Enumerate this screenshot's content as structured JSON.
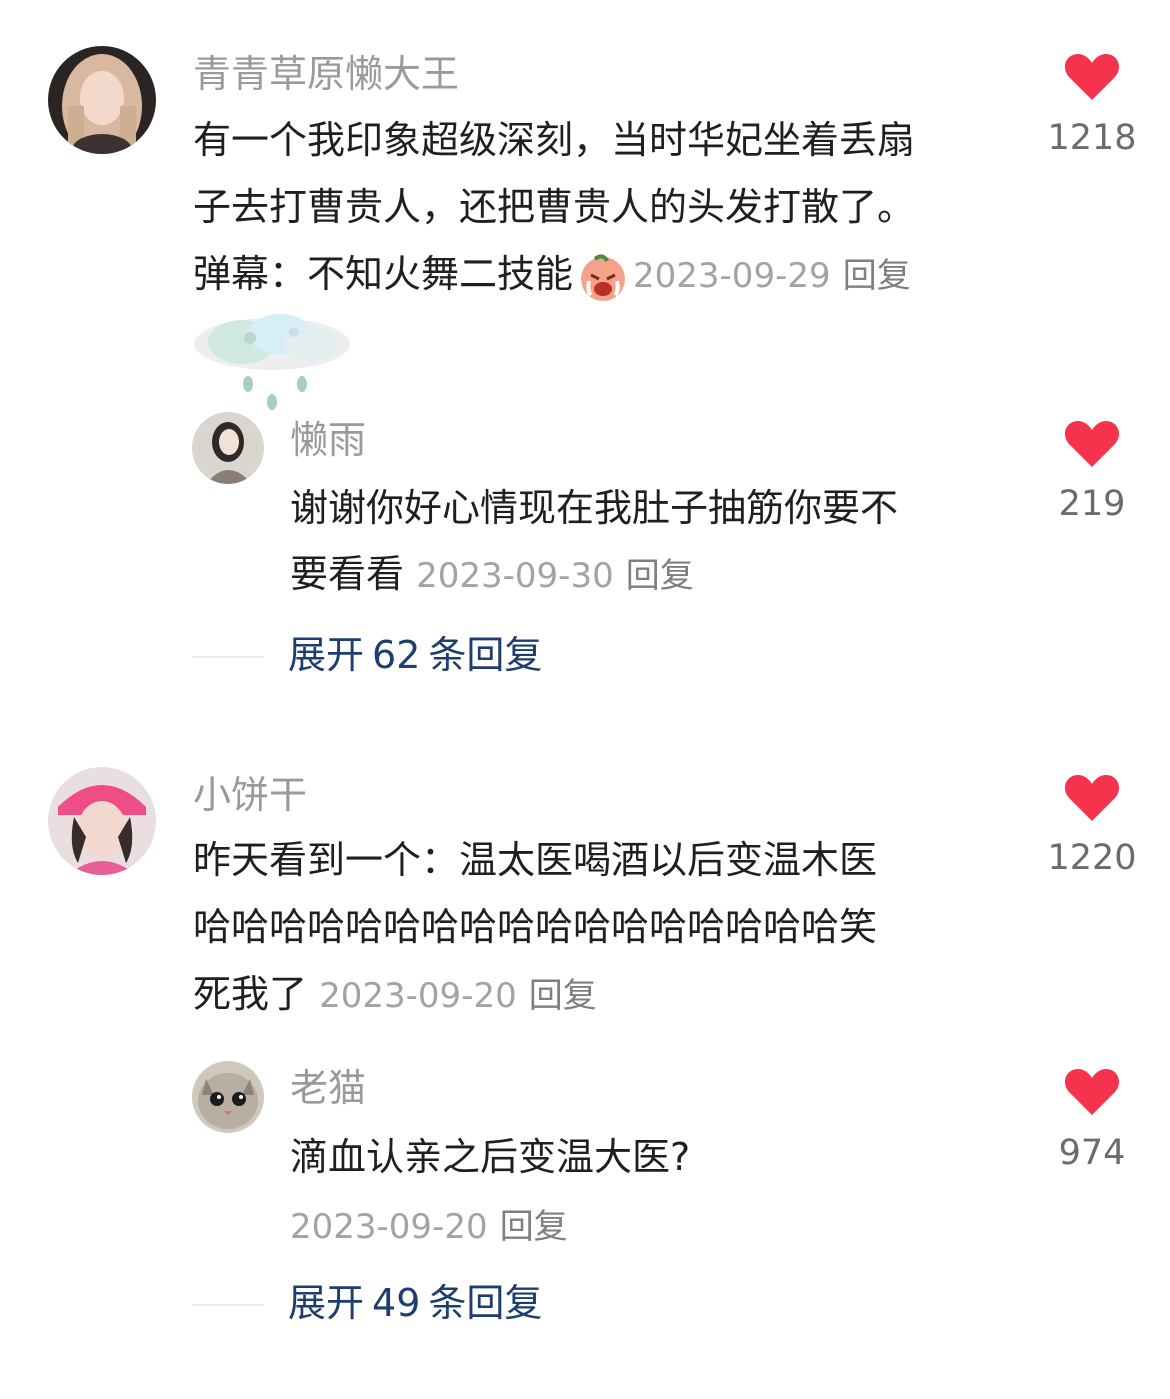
{
  "comments": [
    {
      "username": "青青草原懒大王",
      "lines": [
        "有一个我印象超级深刻，当时华妃坐着丢扇",
        "子去打曹贵人，还把曹贵人的头发打散了。",
        "弹幕：不知火舞二技能"
      ],
      "date": "2023-09-29",
      "reply_label": "回复",
      "likes": "1218",
      "reply": {
        "username": "懒雨",
        "lines": [
          "谢谢你好心情现在我肚子抽筋你要不",
          "要看看"
        ],
        "date": "2023-09-30",
        "reply_label": "回复",
        "likes": "219"
      },
      "expand": {
        "prefix": "展开",
        "count": "62",
        "suffix": "条回复"
      }
    },
    {
      "username": "小饼干",
      "lines": [
        "昨天看到一个：温太医喝酒以后变温木医",
        "哈哈哈哈哈哈哈哈哈哈哈哈哈哈哈哈哈笑",
        "死我了"
      ],
      "date": "2023-09-20",
      "reply_label": "回复",
      "likes": "1220",
      "reply": {
        "username": "老猫",
        "lines": [
          "滴血认亲之后变温大医?"
        ],
        "date": "2023-09-20",
        "reply_label": "回复",
        "likes": "974"
      },
      "expand": {
        "prefix": "展开",
        "count": "49",
        "suffix": "条回复"
      }
    }
  ],
  "icons": {
    "like": "heart-icon",
    "emoji": "crying-face-emoji",
    "sticker": "rain-cloud-sticker"
  },
  "colors": {
    "like": "#f5334d",
    "link": "#1d3e6e",
    "username": "#9a9a9a",
    "meta": "#a3a3a3"
  }
}
